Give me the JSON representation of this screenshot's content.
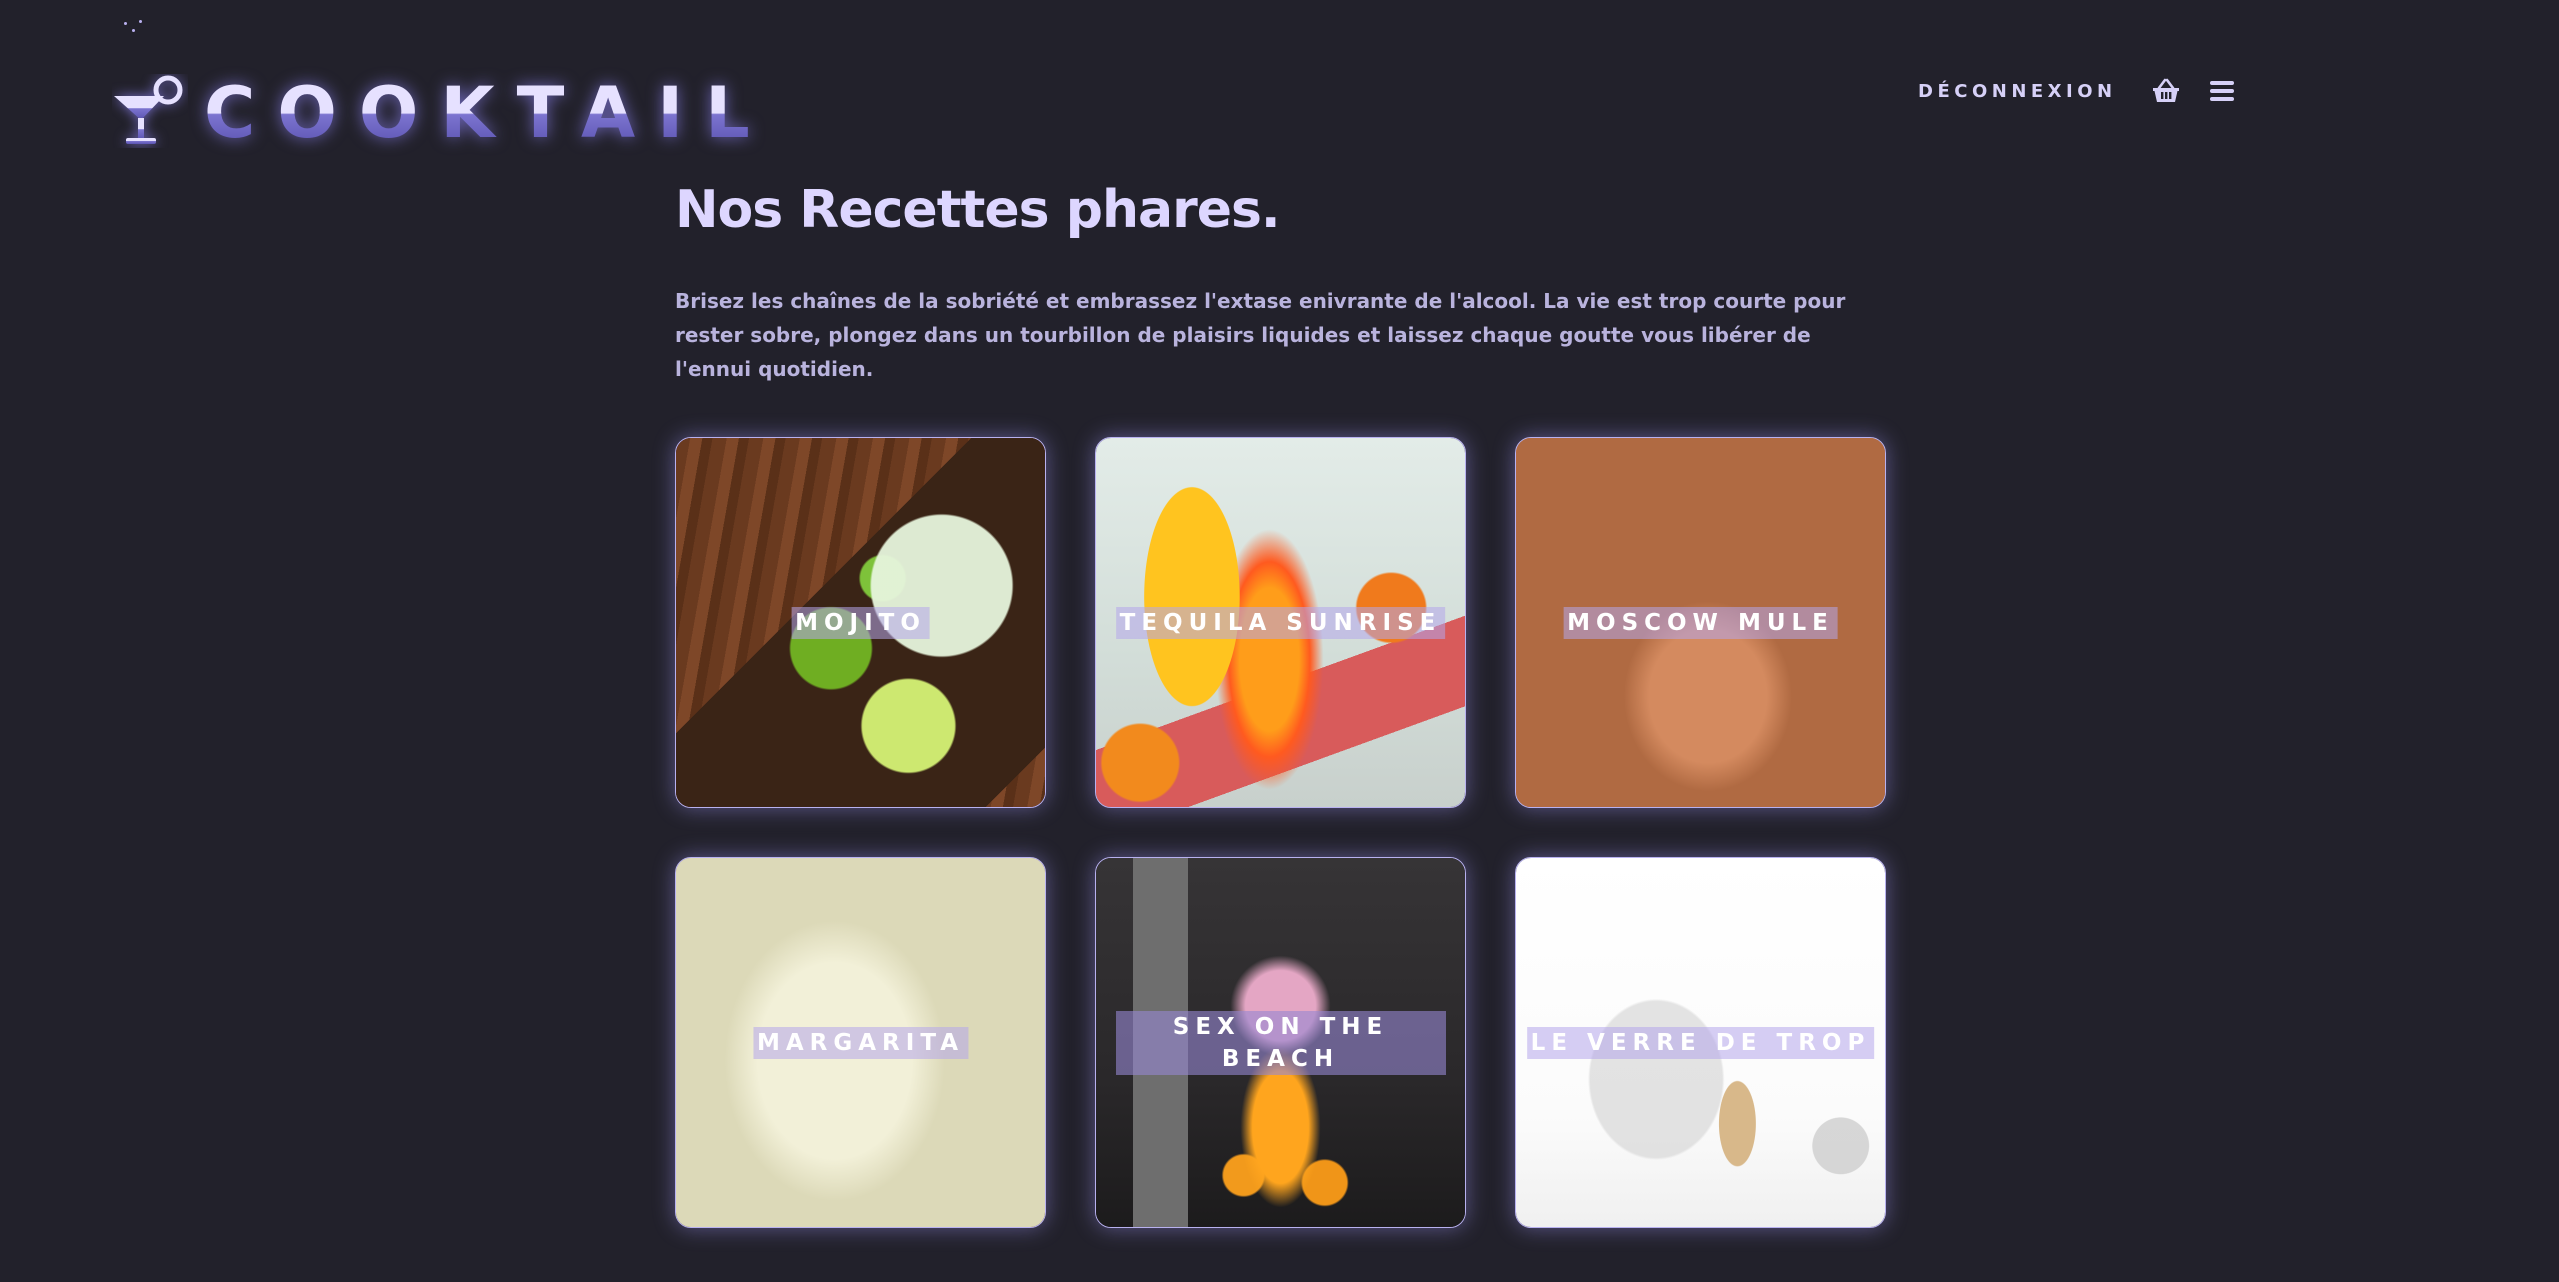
{
  "app": {
    "logo_text": "COOKTAIL"
  },
  "nav": {
    "logout_label": "DÉCONNEXION",
    "cart_icon": "basket-icon",
    "menu_icon": "hamburger-icon"
  },
  "main": {
    "title": "Nos Recettes phares.",
    "intro": "Brisez les chaînes de la sobriété et embrassez l'extase enivrante de l'alcool. La vie est trop courte pour rester sobre, plongez dans un tourbillon de plaisirs liquides et laissez chaque goutte vous libérer de l'ennui quotidien.",
    "recipes": [
      {
        "name": "MOJITO"
      },
      {
        "name": "TEQUILA SUNRISE"
      },
      {
        "name": "MOSCOW MULE"
      },
      {
        "name": "MARGARITA"
      },
      {
        "name": "SEX ON THE BEACH"
      },
      {
        "name": "LE VERRE DE TROP"
      }
    ]
  },
  "colors": {
    "background": "#22212b",
    "accent": "#b8b1f0",
    "text": "#ddd6ff"
  }
}
